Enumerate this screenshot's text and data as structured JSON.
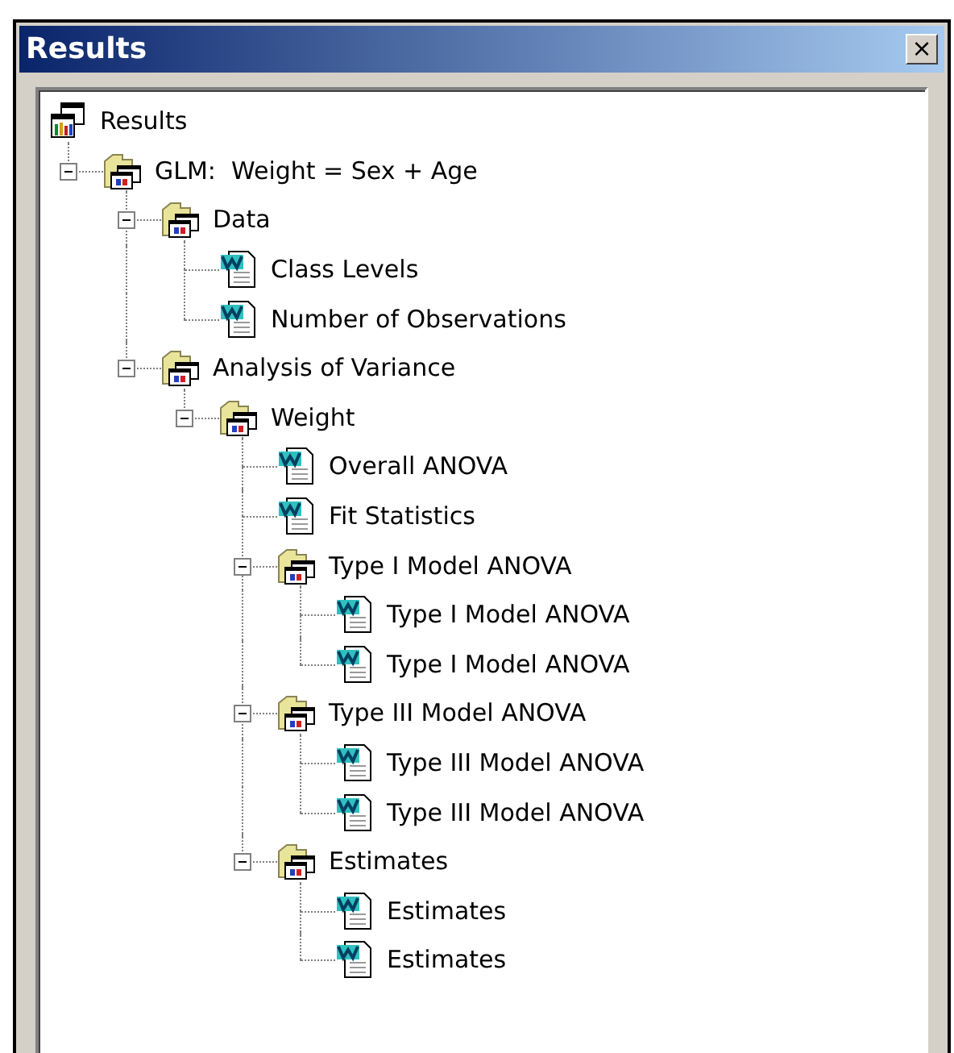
{
  "window": {
    "title": "Results",
    "close_glyph": "×"
  },
  "tree": {
    "label": "Results",
    "kind": "root",
    "children": [
      {
        "label": "GLM:  Weight = Sex + Age",
        "kind": "folder",
        "expanded": true,
        "children": [
          {
            "label": "Data",
            "kind": "folder",
            "expanded": true,
            "children": [
              {
                "label": "Class Levels",
                "kind": "doc"
              },
              {
                "label": "Number of Observations",
                "kind": "doc"
              }
            ]
          },
          {
            "label": "Analysis of Variance",
            "kind": "folder",
            "expanded": true,
            "children": [
              {
                "label": "Weight",
                "kind": "folder",
                "expanded": true,
                "children": [
                  {
                    "label": "Overall ANOVA",
                    "kind": "doc"
                  },
                  {
                    "label": "Fit Statistics",
                    "kind": "doc"
                  },
                  {
                    "label": "Type I Model ANOVA",
                    "kind": "folder",
                    "expanded": true,
                    "children": [
                      {
                        "label": "Type I Model ANOVA",
                        "kind": "doc"
                      },
                      {
                        "label": "Type I Model ANOVA",
                        "kind": "doc"
                      }
                    ]
                  },
                  {
                    "label": "Type III Model ANOVA",
                    "kind": "folder",
                    "expanded": true,
                    "children": [
                      {
                        "label": "Type III Model ANOVA",
                        "kind": "doc"
                      },
                      {
                        "label": "Type III Model ANOVA",
                        "kind": "doc"
                      }
                    ]
                  },
                  {
                    "label": "Estimates",
                    "kind": "folder",
                    "expanded": true,
                    "children": [
                      {
                        "label": "Estimates",
                        "kind": "doc"
                      },
                      {
                        "label": "Estimates",
                        "kind": "doc"
                      }
                    ]
                  }
                ]
              }
            ]
          }
        ]
      }
    ]
  }
}
